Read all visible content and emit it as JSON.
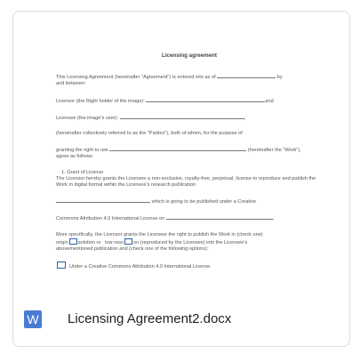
{
  "file": {
    "name": "Licensing Agreement2.docx",
    "type_icon": "word-doc-icon",
    "type_letter": "W",
    "accent_color": "#4a7bd4"
  },
  "document": {
    "title": "Licensing agreement",
    "intro_a": "This Licensing Agreement (hereinafter \"Agreement\") is entered into as of",
    "intro_b": "by",
    "intro_c": "and between:",
    "licensor_label": "Licensor (the Right holder of the image):",
    "licensor_after": "and",
    "licensee_label": "Licensee (the image's user):",
    "licensee_after": ",",
    "parties": "(hereinafter collectively referred to as the \"Parties\"), both of whom, for the purpose of",
    "granting_a": "granting the right to use",
    "granting_b": "(hereinafter the \"Work\"),",
    "granting_c": "agree as follows:",
    "section_heading": "1.   Grant of License",
    "grant_text": "The Licensor hereby grants the Licensee a non-exclusive, royalty-free, perpetual, license to reproduce and publish the Work in digital format within the Licensee's research publication",
    "creative_line": "which is going to be published under a Creative",
    "cc_line": "Commons Attribution 4.0 International License on",
    "specifically_a": "More specifically, the Licensor grants the Licensee the right to publish the Work in (check one)",
    "specifically_b1": "origin",
    "specifically_b2": "solution or",
    "specifically_b3": "low reso",
    "specifically_b4": "on (reproduced by the Licensee) into the Licensee's",
    "specifically_c": "abovementioned publication and (check one of the following options):",
    "option_cc": "Under a Creative Commons Attribution 4.0 International License."
  }
}
